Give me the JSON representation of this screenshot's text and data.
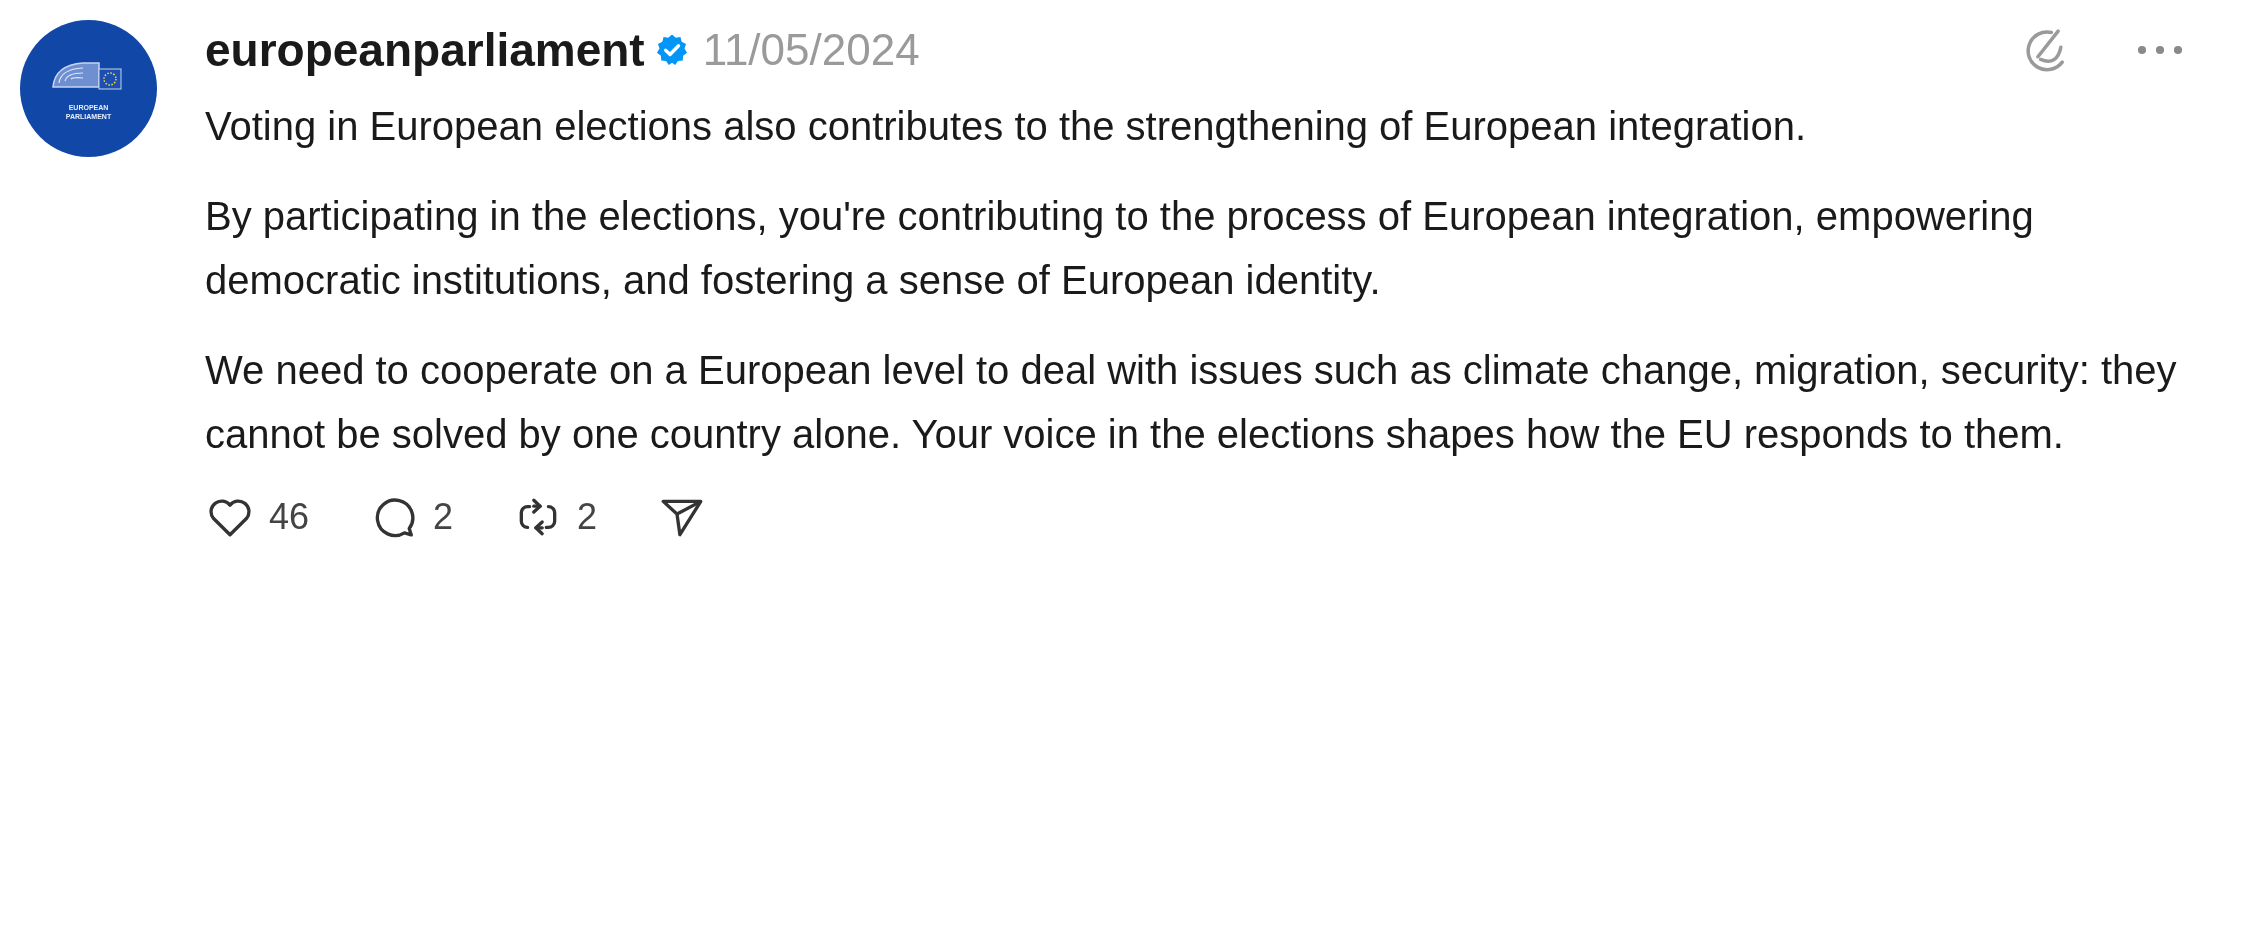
{
  "post": {
    "avatar": {
      "caption": [
        "EUROPEAN",
        "PARLIAMENT"
      ]
    },
    "username": "europeanparliament",
    "verified": true,
    "date": "11/05/2024",
    "paragraphs": [
      "Voting in European elections also contributes to the strengthening of European integration.",
      "By participating in the elections, you're contributing to the process of European integration, empowering democratic institutions, and fostering a sense of European identity.",
      "We need to cooperate on a European level to deal with issues such as climate change, migration, security: they cannot be solved by one country alone. Your voice in the elections shapes how the EU responds to them."
    ],
    "actions": [
      {
        "kind": "like",
        "count": "46"
      },
      {
        "kind": "comment",
        "count": "2"
      },
      {
        "kind": "repost",
        "count": "2"
      },
      {
        "kind": "share"
      }
    ]
  }
}
